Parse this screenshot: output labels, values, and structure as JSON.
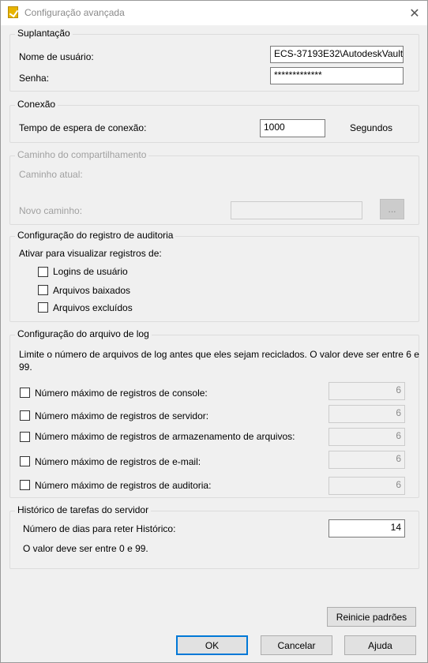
{
  "window": {
    "title": "Configuração avançada",
    "close_glyph": "✕",
    "icon": "vault-app-icon"
  },
  "impersonation": {
    "legend": "Suplantação",
    "username_label": "Nome de usuário:",
    "username_value": "ECS-37193E32\\AutodeskVault",
    "password_label": "Senha:",
    "password_value": "*************"
  },
  "connection": {
    "legend": "Conexão",
    "timeout_label": "Tempo de espera de conexão:",
    "timeout_value": "1000",
    "unit": "Segundos"
  },
  "share_path": {
    "legend": "Caminho do compartilhamento",
    "current_label": "Caminho atual:",
    "new_label": "Novo caminho:",
    "new_value": "",
    "browse_label": "..."
  },
  "audit": {
    "legend": "Configuração do registro de auditoria",
    "intro": "Ativar para visualizar registros de:",
    "options": [
      {
        "label": "Logins de usuário",
        "checked": false
      },
      {
        "label": "Arquivos baixados",
        "checked": false
      },
      {
        "label": "Arquivos excluídos",
        "checked": false
      }
    ]
  },
  "logfile": {
    "legend": "Configuração do arquivo de log",
    "description_line1": "Limite o número de arquivos de log antes que eles sejam reciclados. O valor deve ser entre 6 e",
    "description_line2": "99.",
    "rows": [
      {
        "label": "Número máximo de registros de console:",
        "value": "6",
        "checked": false
      },
      {
        "label": "Número máximo de registros de servidor:",
        "value": "6",
        "checked": false
      },
      {
        "label": "Número máximo de registros de armazenamento de arquivos:",
        "value": "6",
        "checked": false
      },
      {
        "label": "Número máximo de registros de e-mail:",
        "value": "6",
        "checked": false
      },
      {
        "label": "Número máximo de registros de auditoria:",
        "value": "6",
        "checked": false
      }
    ]
  },
  "history": {
    "legend": "Histórico de tarefas do servidor",
    "days_label": "Número de dias para reter Histórico:",
    "days_value": "14",
    "note": "O valor deve ser entre 0 e 99."
  },
  "buttons": {
    "reset": "Reinicie padrões",
    "ok": "OK",
    "cancel": "Cancelar",
    "help": "Ajuda"
  }
}
